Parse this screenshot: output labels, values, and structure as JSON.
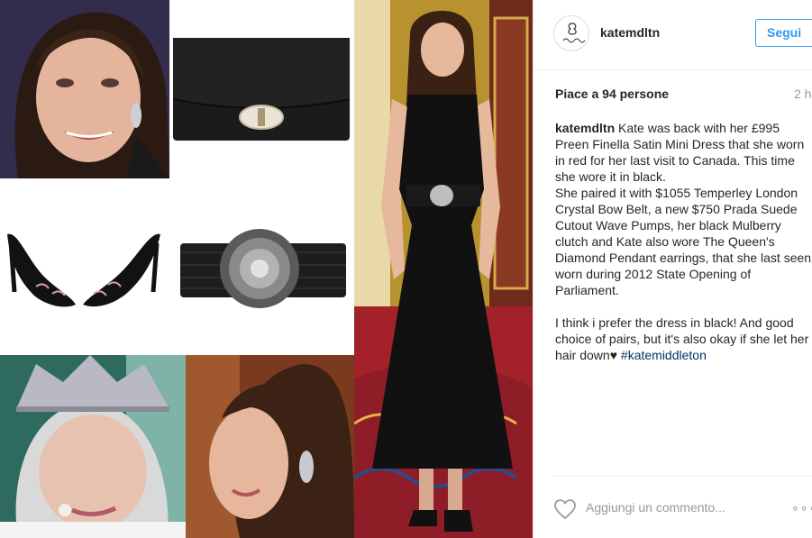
{
  "post": {
    "username": "katemdltn",
    "follow_label": "Segui",
    "likes": "Piace a 94 persone",
    "time": "2 h",
    "caption": {
      "user": "katemdltn",
      "line1": "Kate was back with her £995 Preen Finella Satin Mini Dress that she worn in red for her last visit to Canada. This time she wore it in black.",
      "line2": "She paired it with $1055 Temperley London Crystal Bow Belt, a new $750 Prada Suede Cutout Wave Pumps, her black Mulberry clutch and Kate also wore The Queen's Diamond Pendant earrings, that she last seen worn during 2012 State Opening of Parliament.",
      "line3": "I think i prefer the dress in black! And good choice of pairs, but it's also okay if she let her hair down♥",
      "hashtag": "#katemiddleton"
    },
    "comment_placeholder": "Aggiungi un commento...",
    "more_label": "∘∘∘"
  },
  "colors": {
    "accent": "#3897f0",
    "hashtag": "#003569",
    "muted": "#999999",
    "border": "#efefef"
  },
  "icons": {
    "heart": "heart-icon",
    "more": "more-options-icon"
  }
}
